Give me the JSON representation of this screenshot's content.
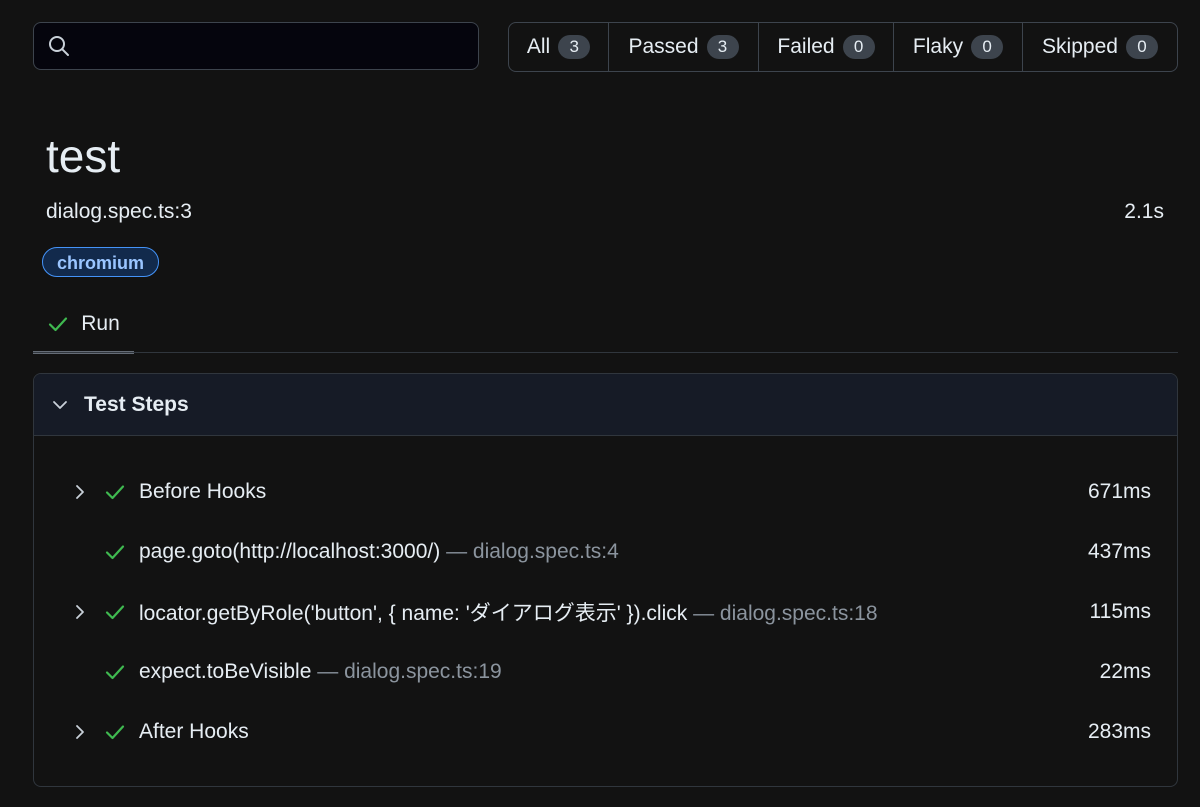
{
  "search": {
    "value": "",
    "placeholder": ""
  },
  "filters": [
    {
      "label": "All",
      "count": "3"
    },
    {
      "label": "Passed",
      "count": "3"
    },
    {
      "label": "Failed",
      "count": "0"
    },
    {
      "label": "Flaky",
      "count": "0"
    },
    {
      "label": "Skipped",
      "count": "0"
    }
  ],
  "test": {
    "title": "test",
    "location": "dialog.spec.ts:3",
    "duration": "2.1s",
    "project": "chromium"
  },
  "tabs": {
    "run_label": "Run"
  },
  "steps_panel": {
    "title": "Test Steps",
    "steps": [
      {
        "title": "Before Hooks",
        "location": "",
        "duration": "671ms",
        "expandable": true
      },
      {
        "title": "page.goto(http://localhost:3000/)",
        "location": "— dialog.spec.ts:4",
        "duration": "437ms",
        "expandable": false
      },
      {
        "title": "locator.getByRole('button', { name: 'ダイアログ表示' }).click",
        "location": "— dialog.spec.ts:18",
        "duration": "115ms",
        "expandable": true
      },
      {
        "title": "expect.toBeVisible",
        "location": "— dialog.spec.ts:19",
        "duration": "22ms",
        "expandable": false
      },
      {
        "title": "After Hooks",
        "location": "",
        "duration": "283ms",
        "expandable": true
      }
    ]
  },
  "colors": {
    "background": "#121212",
    "passed_check": "#3fb950",
    "badge_border": "#4493f8",
    "badge_text": "#9ac5ff"
  },
  "icons": {
    "search": "search-icon",
    "status": "check-icon",
    "expand": "chevron-right-icon",
    "collapse": "chevron-down-icon"
  }
}
